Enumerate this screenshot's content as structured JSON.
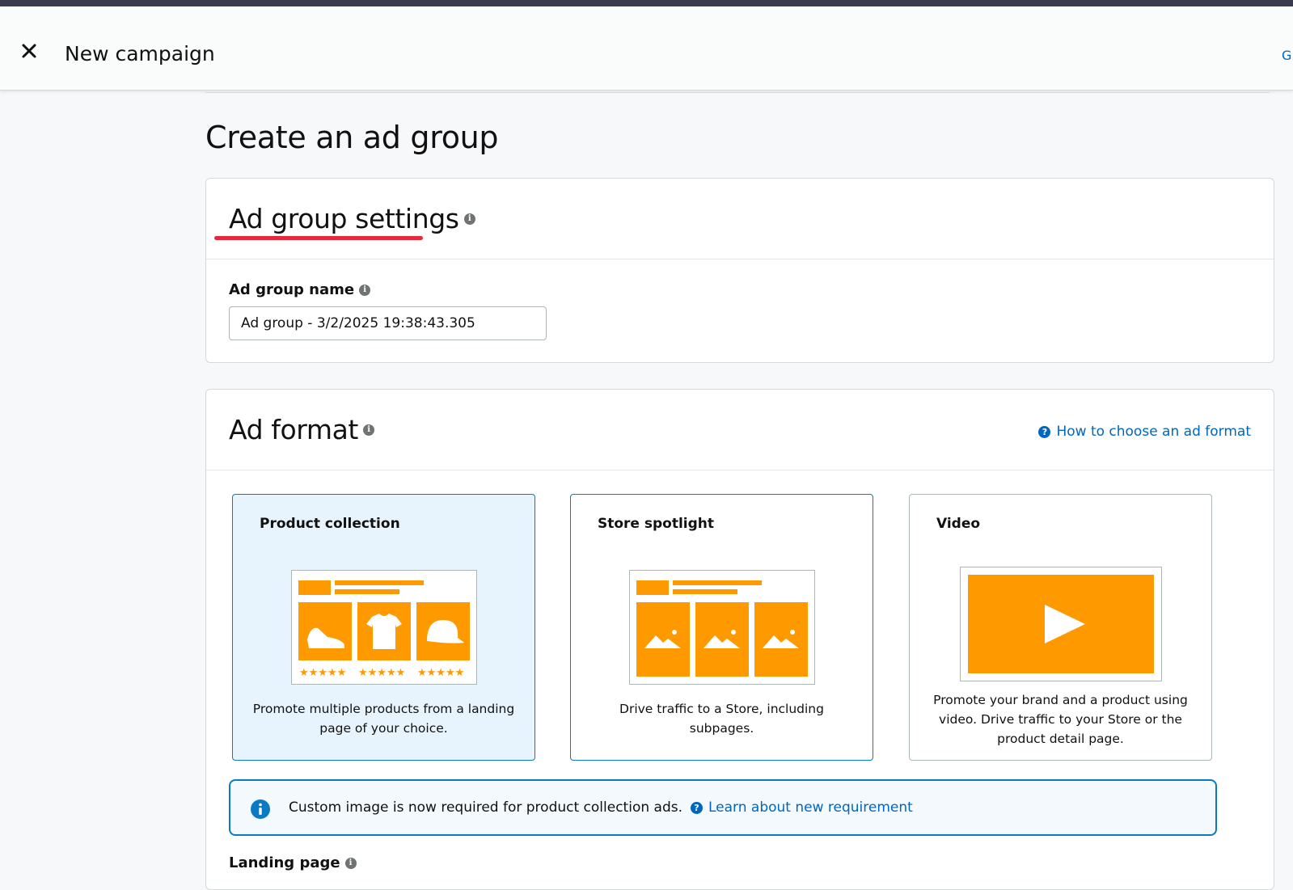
{
  "header": {
    "title": "New campaign",
    "right_text": "G"
  },
  "page": {
    "title": "Create an ad group"
  },
  "ad_group_settings": {
    "heading": "Ad group settings",
    "name_label": "Ad group name",
    "name_value": "Ad group - 3/2/2025 19:38:43.305"
  },
  "ad_format": {
    "heading": "Ad format",
    "help_link": "How to choose an ad format",
    "options": [
      {
        "title": "Product collection",
        "description": "Promote multiple products from a landing page of your choice.",
        "selected": true
      },
      {
        "title": "Store spotlight",
        "description": "Drive traffic to a Store, including subpages.",
        "selected": false
      },
      {
        "title": "Video",
        "description": "Promote your brand and a product using video. Drive traffic to your Store or the product detail page.",
        "selected": false
      }
    ],
    "notice": {
      "text": "Custom image is now required for product collection ads.",
      "link": "Learn about new requirement"
    },
    "landing_page_label": "Landing page"
  },
  "colors": {
    "accent_orange": "#ff9900",
    "link_blue": "#0066c0",
    "selected_bg": "#e7f4fd",
    "annotation_red": "#e5283b"
  }
}
